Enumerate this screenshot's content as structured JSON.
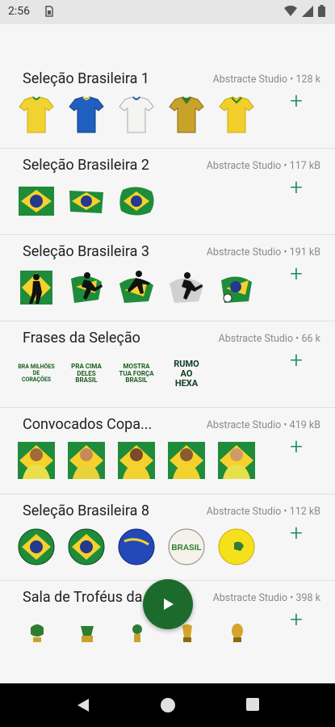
{
  "status": {
    "time": "2:56"
  },
  "packs": [
    {
      "title": "Seleção Brasileira 1",
      "meta": "Abstracte Studio • 128 k",
      "add": "+"
    },
    {
      "title": "Seleção Brasileira 2",
      "meta": "Abstracte Studio • 117 kB",
      "add": "+"
    },
    {
      "title": "Seleção Brasileira 3",
      "meta": "Abstracte Studio • 191 kB",
      "add": "+"
    },
    {
      "title": "Frases da Seleção",
      "meta": "Abstracte Studio • 66 k",
      "add": "+"
    },
    {
      "title": "Convocados Copa...",
      "meta": "Abstracte Studio • 419 kB",
      "add": "+"
    },
    {
      "title": "Seleção Brasileira 8",
      "meta": "Abstracte Studio • 112 kB",
      "add": "+"
    },
    {
      "title": "Sala de Troféus da",
      "meta": "Abstracte Studio • 398 k",
      "add": "+"
    }
  ],
  "phrase_stickers": [
    "BRA MILHÕES DE CORAÇÕES",
    "PRA CIMA DELES BRASIL",
    "MOSTRA TUA FORÇA BRASIL",
    "RUMO AO HEXA"
  ],
  "ball_text": "BRASIL"
}
